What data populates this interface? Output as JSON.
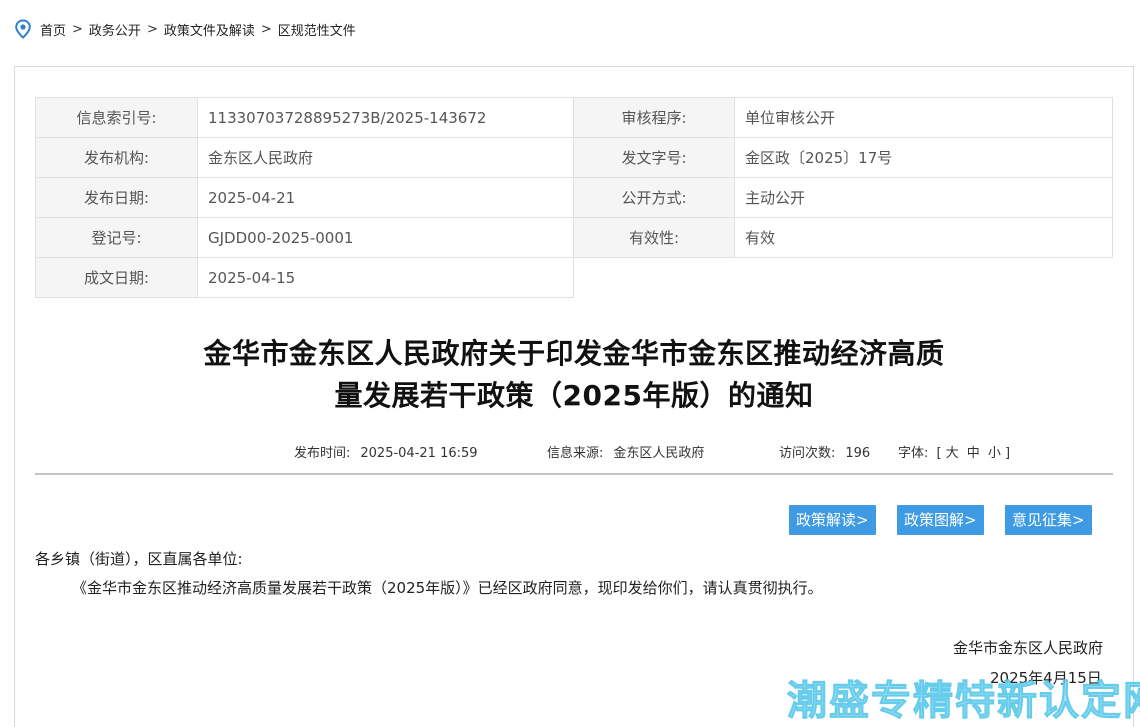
{
  "breadcrumb": {
    "items": [
      "首页",
      "政务公开",
      "政策文件及解读",
      "区规范性文件"
    ],
    "separator": ">"
  },
  "meta": {
    "index_label": "信息索引号:",
    "index_value": "11330703728895273B/2025-143672",
    "review_label": "审核程序:",
    "review_value": "单位审核公开",
    "org_label": "发布机构:",
    "org_value": "金东区人民政府",
    "docno_label": "发文字号:",
    "docno_value": "金区政〔2025〕17号",
    "date_label": "发布日期:",
    "date_value": "2025-04-21",
    "public_label": "公开方式:",
    "public_value": "主动公开",
    "reg_label": "登记号:",
    "reg_value": "GJDD00-2025-0001",
    "valid_label": "有效性:",
    "valid_value": "有效",
    "created_label": "成文日期:",
    "created_value": "2025-04-15"
  },
  "title": {
    "line1": "金华市金东区人民政府关于印发金华市金东区推动经济高质",
    "line2": "量发展若干政策（2025年版）的通知"
  },
  "info": {
    "time_label": "发布时间:",
    "time_value": "2025-04-21 16:59",
    "source_label": "信息来源:",
    "source_value": "金东区人民政府",
    "visits_label": "访问次数:",
    "visits_value": "196",
    "font_label": "字体:",
    "bracket_open": "[",
    "font_large": "大",
    "font_medium": "中",
    "font_small": "小",
    "bracket_close": "]"
  },
  "buttons": {
    "interpretation": "政策解读>",
    "graphic": "政策图解>",
    "feedback": "意见征集>"
  },
  "body": {
    "salutation": "各乡镇（街道），区直属各单位:",
    "paragraph": "《金华市金东区推动经济高质量发展若干政策（2025年版）》已经区政府同意，现印发给你们，请认真贯彻执行。",
    "signature": "金华市金东区人民政府",
    "date": "2025年4月15日"
  },
  "watermark": "潮盛专精特新认定网",
  "colors": {
    "accent": "#3d9ae3",
    "pin": "#2d7fd3",
    "label_bg": "#f5f5f5"
  }
}
